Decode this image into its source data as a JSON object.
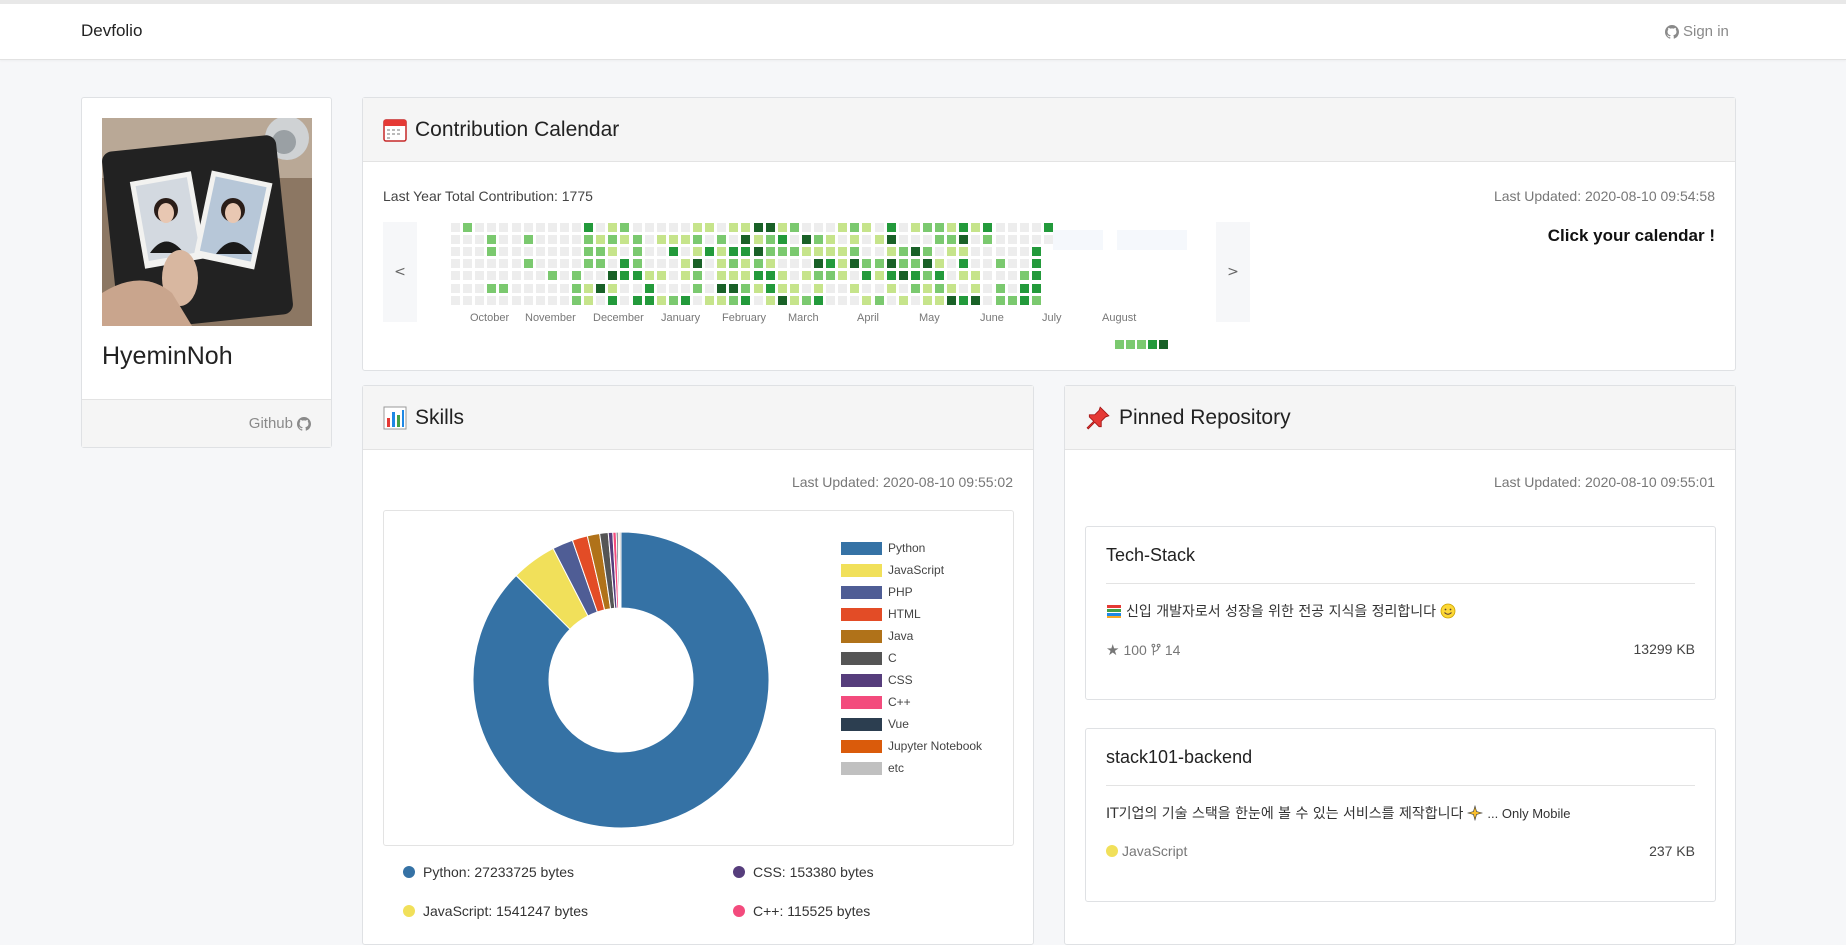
{
  "navbar": {
    "brand": "Devfolio",
    "signin": "Sign in"
  },
  "profile": {
    "name": "HyeminNoh",
    "github_label": "Github"
  },
  "calendar": {
    "title": "Contribution Calendar",
    "total": "Last Year Total Contribution: 1775",
    "updated": "Last Updated: 2020-08-10 09:54:58",
    "hint": "Click your calendar !",
    "prev": "<",
    "next": ">",
    "months": [
      "October",
      "November",
      "December",
      "January",
      "February",
      "March",
      "April",
      "May",
      "June",
      "July",
      "August"
    ],
    "colors": [
      "#ededed",
      "#c6e48b",
      "#7bc96f",
      "#239a3b",
      "#196127"
    ]
  },
  "skills": {
    "title": "Skills",
    "updated": "Last Updated: 2020-08-10 09:55:02",
    "chart_data": {
      "type": "pie",
      "categories": [
        "Python",
        "JavaScript",
        "PHP",
        "HTML",
        "Java",
        "C",
        "CSS",
        "C++",
        "Vue",
        "Jupyter Notebook",
        "etc"
      ],
      "values": [
        27233725,
        1541247,
        700000,
        520000,
        420000,
        290000,
        153380,
        115525,
        60000,
        40000,
        60000
      ],
      "colors": [
        "#3572A5",
        "#f1e05a",
        "#4F5D95",
        "#e34c26",
        "#b07219",
        "#555555",
        "#563d7c",
        "#f34b7d",
        "#2c3e50",
        "#DA5B0B",
        "#c0c0c0"
      ],
      "legend": "right"
    },
    "bytes": [
      {
        "label": "Python: 27233725 bytes",
        "color": "#3572A5"
      },
      {
        "label": "CSS: 153380 bytes",
        "color": "#563d7c"
      },
      {
        "label": "JavaScript: 1541247 bytes",
        "color": "#f1e05a"
      },
      {
        "label": "C++: 115525 bytes",
        "color": "#f34b7d"
      }
    ]
  },
  "pinned": {
    "title": "Pinned Repository",
    "updated": "Last Updated: 2020-08-10 09:55:01",
    "repos": [
      {
        "name": "Tech-Stack",
        "desc": "신입 개발자로서 성장을 위한 전공 지식을 정리합니다",
        "stars": "100",
        "forks": "14",
        "size": "13299 KB"
      },
      {
        "name": "stack101-backend",
        "desc": "IT기업의 기술 스택을 한눈에 볼 수 있는 서비스를 제작합니다",
        "desc_tail": "... Only Mobile",
        "lang": "JavaScript",
        "lang_color": "#f1e05a",
        "size": "237 KB"
      }
    ]
  }
}
